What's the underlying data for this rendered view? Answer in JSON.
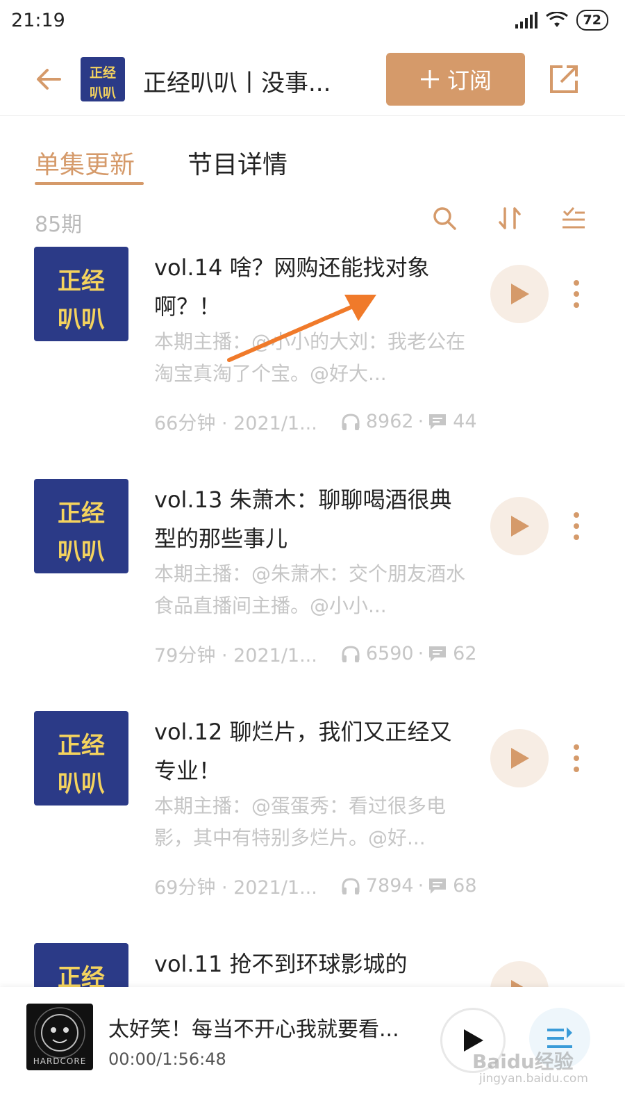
{
  "status_bar": {
    "time": "21:19",
    "battery": "72"
  },
  "header": {
    "title": "正经叭叭丨没事...",
    "subscribe_label": "订阅",
    "cover_text_top": "正经",
    "cover_text_bottom": "叭叭"
  },
  "tabs": [
    {
      "label": "单集更新",
      "active": true
    },
    {
      "label": "节目详情",
      "active": false
    }
  ],
  "episode_count": "85期",
  "episodes": [
    {
      "title": "vol.14 啥？网购还能找对象啊？！",
      "desc": "本期主播：@小小的大刘：我老公在淘宝真淘了个宝。@好大...",
      "duration_date": "66分钟 · 2021/1...",
      "plays": "8962",
      "comments": "44"
    },
    {
      "title": "vol.13 朱萧木：聊聊喝酒很典型的那些事儿",
      "desc": "本期主播：@朱萧木：交个朋友酒水食品直播间主播。@小小...",
      "duration_date": "79分钟 · 2021/1...",
      "plays": "6590",
      "comments": "62"
    },
    {
      "title": "vol.12 聊烂片，我们又正经又专业！",
      "desc": "本期主播：@蛋蛋秀：看过很多电影，其中有特别多烂片。@好...",
      "duration_date": "69分钟 · 2021/1...",
      "plays": "7894",
      "comments": "68"
    },
    {
      "title": "vol.11 抢不到环球影城的",
      "desc": "",
      "duration_date": "",
      "plays": "",
      "comments": ""
    }
  ],
  "player": {
    "title": "太好笑！每当不开心我就要看...",
    "time": "00:00/1:56:48",
    "cover_text": "HARDCORE"
  },
  "watermark": {
    "main": "Baidu经验",
    "sub": "jingyan.baidu.com"
  },
  "colors": {
    "accent": "#d59a6a",
    "cover_bg": "#2b3a87",
    "cover_text": "#f4d35e",
    "arrow": "#f07a2a"
  }
}
